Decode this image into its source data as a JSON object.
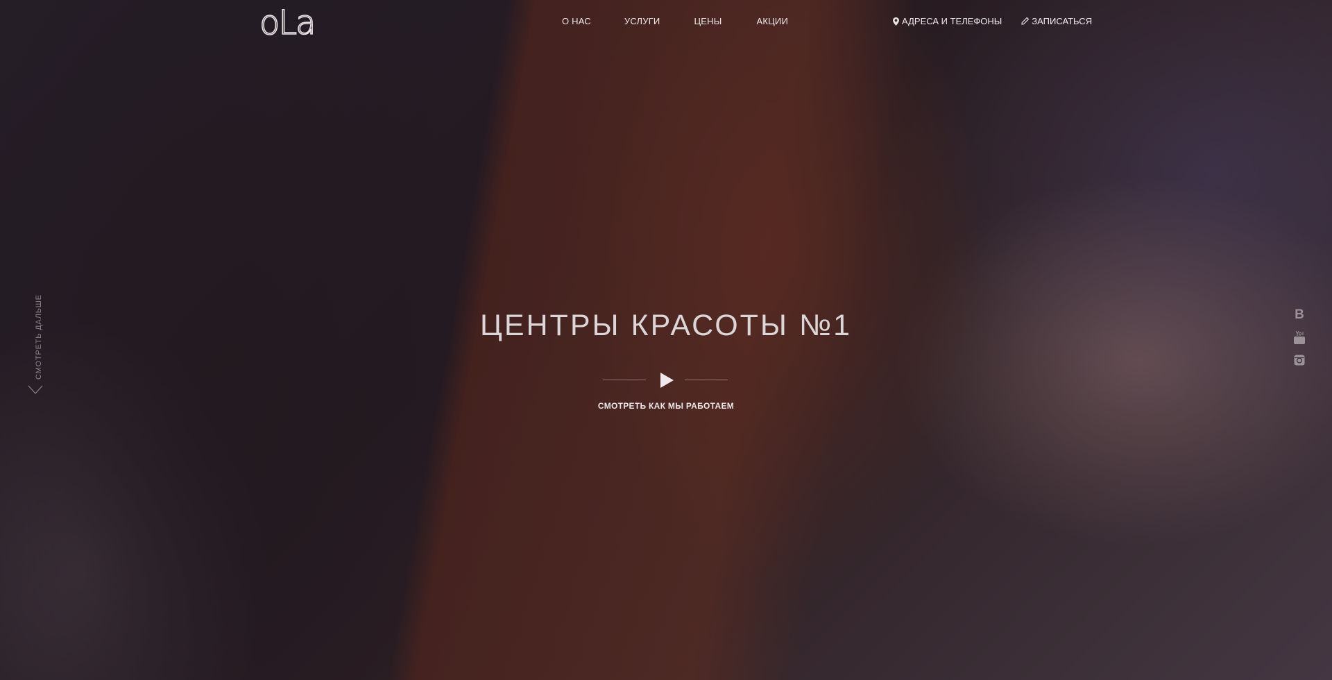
{
  "header": {
    "logo_text": "oLa",
    "nav": [
      {
        "label": "О НАС"
      },
      {
        "label": "УСЛУГИ"
      },
      {
        "label": "ЦЕНЫ"
      },
      {
        "label": "АКЦИИ"
      }
    ],
    "addresses_label": "АДРЕСА И ТЕЛЕФОНЫ",
    "signup_label": "ЗАПИСАТЬСЯ"
  },
  "hero": {
    "title": "ЦЕНТРЫ КРАСОТЫ №1",
    "play_caption": "СМОТРЕТЬ КАК МЫ РАБОТАЕМ",
    "scroll_hint": "СМОТРЕТЬ ДАЛЬШЕ"
  },
  "social": {
    "vk_glyph": "B",
    "icons": [
      "vk-icon",
      "youtube-icon",
      "instagram-icon"
    ]
  },
  "colors": {
    "text": "#f0ebec",
    "muted": "#8d8489"
  }
}
